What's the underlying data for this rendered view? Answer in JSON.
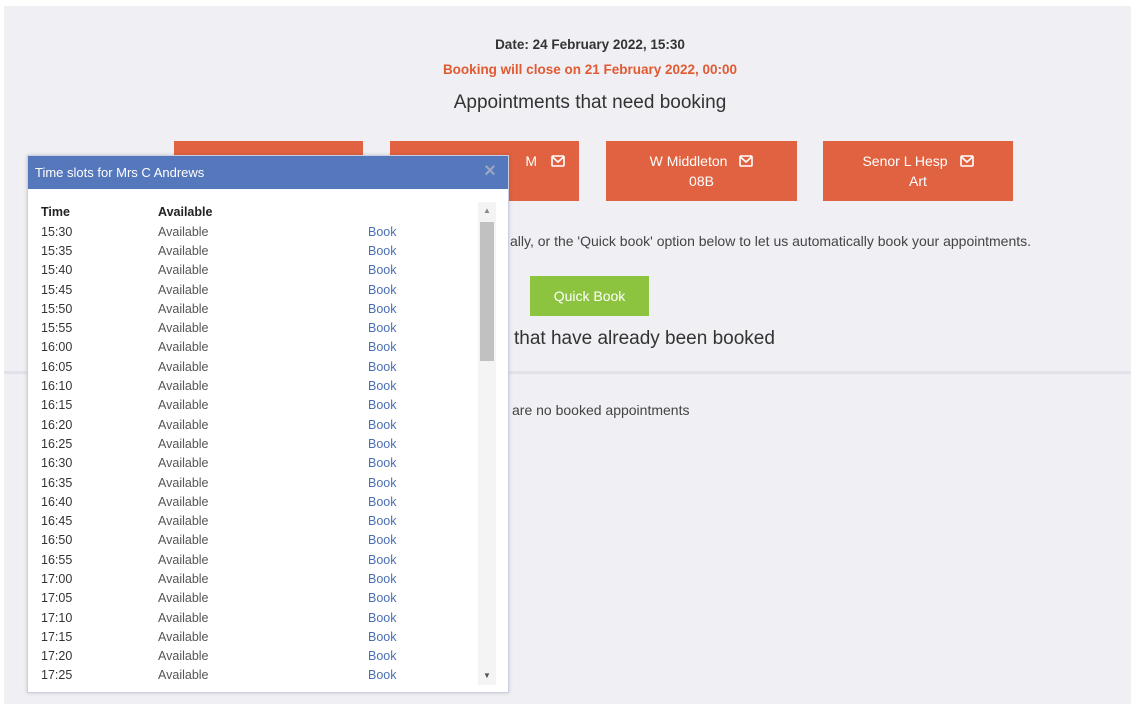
{
  "header": {
    "date_line": "Date: 24 February 2022, 15:30",
    "close_line": "Booking will close on 21 February 2022, 00:00",
    "need_heading": "Appointments that need booking"
  },
  "teachers": [
    {
      "name": "",
      "sub": ""
    },
    {
      "name": "M",
      "sub": ""
    },
    {
      "name": "W Middleton",
      "sub": "08B"
    },
    {
      "name": "Senor L Hesp",
      "sub": "Art"
    }
  ],
  "instructions": "ally, or the 'Quick book' option below to let us automatically book your appointments.",
  "quick_book_label": "Quick Book",
  "booked_heading": "that have already been booked",
  "no_booked": "are no booked appointments",
  "modal": {
    "title": "Time slots for Mrs C Andrews",
    "close_glyph": "×",
    "col_time": "Time",
    "col_available": "Available",
    "slots": [
      {
        "time": "15:30",
        "status": "Available",
        "action": "Book"
      },
      {
        "time": "15:35",
        "status": "Available",
        "action": "Book"
      },
      {
        "time": "15:40",
        "status": "Available",
        "action": "Book"
      },
      {
        "time": "15:45",
        "status": "Available",
        "action": "Book"
      },
      {
        "time": "15:50",
        "status": "Available",
        "action": "Book"
      },
      {
        "time": "15:55",
        "status": "Available",
        "action": "Book"
      },
      {
        "time": "16:00",
        "status": "Available",
        "action": "Book"
      },
      {
        "time": "16:05",
        "status": "Available",
        "action": "Book"
      },
      {
        "time": "16:10",
        "status": "Available",
        "action": "Book"
      },
      {
        "time": "16:15",
        "status": "Available",
        "action": "Book"
      },
      {
        "time": "16:20",
        "status": "Available",
        "action": "Book"
      },
      {
        "time": "16:25",
        "status": "Available",
        "action": "Book"
      },
      {
        "time": "16:30",
        "status": "Available",
        "action": "Book"
      },
      {
        "time": "16:35",
        "status": "Available",
        "action": "Book"
      },
      {
        "time": "16:40",
        "status": "Available",
        "action": "Book"
      },
      {
        "time": "16:45",
        "status": "Available",
        "action": "Book"
      },
      {
        "time": "16:50",
        "status": "Available",
        "action": "Book"
      },
      {
        "time": "16:55",
        "status": "Available",
        "action": "Book"
      },
      {
        "time": "17:00",
        "status": "Available",
        "action": "Book"
      },
      {
        "time": "17:05",
        "status": "Available",
        "action": "Book"
      },
      {
        "time": "17:10",
        "status": "Available",
        "action": "Book"
      },
      {
        "time": "17:15",
        "status": "Available",
        "action": "Book"
      },
      {
        "time": "17:20",
        "status": "Available",
        "action": "Book"
      },
      {
        "time": "17:25",
        "status": "Available",
        "action": "Book"
      }
    ]
  },
  "colors": {
    "accent_orange": "#e06240",
    "quick_book_green": "#8dc43f",
    "modal_header_blue": "#5577bb",
    "link_blue": "#4a6fb5"
  },
  "icons": {
    "mail": "mail-icon",
    "close": "close-icon"
  }
}
